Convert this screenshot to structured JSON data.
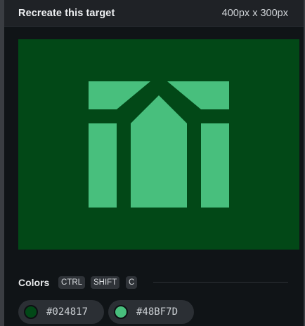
{
  "header": {
    "title": "Recreate this target",
    "dimensions": "400px x 300px"
  },
  "target": {
    "background": "#024817",
    "shape_color": "#48BF7D"
  },
  "colors_section": {
    "label": "Colors",
    "shortcut_keys": [
      "CTRL",
      "SHIFT",
      "C"
    ]
  },
  "swatches": [
    {
      "hex": "#024817",
      "color": "#024817"
    },
    {
      "hex": "#48BF7D",
      "color": "#48BF7D"
    }
  ]
}
